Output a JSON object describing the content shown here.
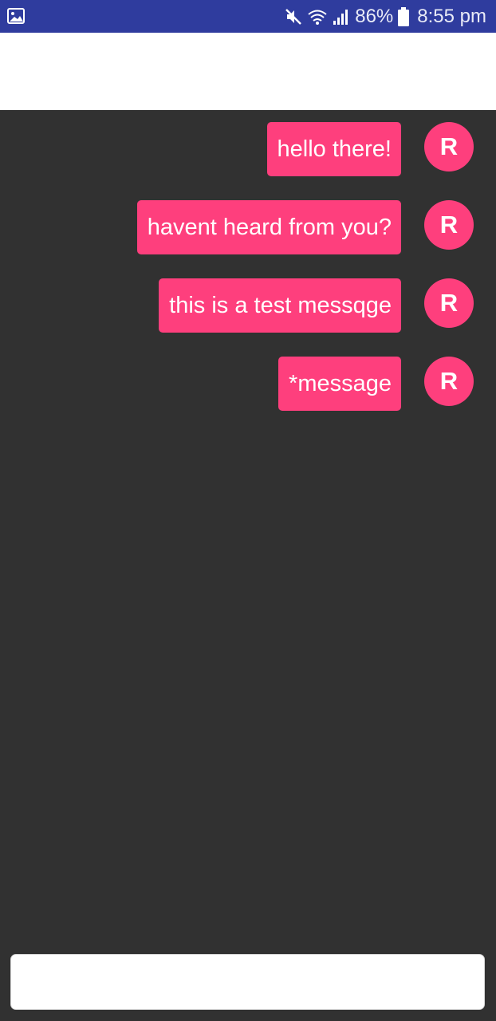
{
  "status_bar": {
    "notification_icon": "image-icon",
    "mute_icon": "vibrate-off-icon",
    "wifi_icon": "wifi-icon",
    "signal_icon": "signal-icon",
    "battery_icon": "battery-icon",
    "battery_percent": "86%",
    "time": "8:55 pm"
  },
  "messages": [
    {
      "text": "hello there!",
      "avatar_initial": "R"
    },
    {
      "text": "havent heard from you?",
      "avatar_initial": "R"
    },
    {
      "text": "this is a test messqge",
      "avatar_initial": "R"
    },
    {
      "text": "*message",
      "avatar_initial": "R"
    }
  ],
  "composer": {
    "value": "",
    "placeholder": ""
  },
  "colors": {
    "status_bar": "#2f3c9e",
    "background": "#313131",
    "bubble": "#fe3f7d",
    "app_bar": "#ffffff"
  }
}
